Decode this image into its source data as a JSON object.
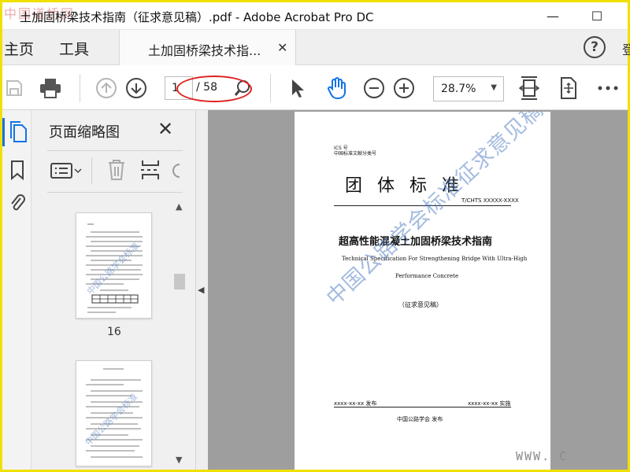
{
  "window": {
    "title": "土加固桥梁技术指南（征求意见稿）.pdf - Adobe Acrobat Pro DC",
    "watermark_top": "中国道桥网",
    "minimize": "—",
    "maximize": "☐"
  },
  "tabs": {
    "home": "主页",
    "tools": "工具",
    "document": "土加固桥梁技术指...",
    "document_close": "✕",
    "help": "?",
    "cut_label": "登"
  },
  "toolbar": {
    "current_page": "1",
    "total_pages": "/ 58",
    "zoom": "28.7%"
  },
  "thumbnails_panel": {
    "title": "页面缩略图",
    "close": "✕",
    "pages": [
      {
        "label": "16"
      },
      {
        "label": ""
      }
    ]
  },
  "document_page": {
    "ics": "ICS 号",
    "classification": "中国标准文献分类号",
    "category": "团  体  标  准",
    "standard_number": "T/CHTS XXXXX-XXXX",
    "title_cn": "超高性能混凝土加固桥梁技术指南",
    "title_en_line1": "Technical Specification For Strengthening Bridge With Ultra-High",
    "title_en_line2": "Performance Concrete",
    "draft_note": "（征求意见稿）",
    "issue_date": "xxxx-xx-xx 发布",
    "implement_date": "xxxx-xx-xx 实施",
    "publisher": "中国公路学会  发布",
    "watermark": "中国公路学会标准征求意见稿"
  },
  "footer_watermark": "WWW. C",
  "colors": {
    "frame": "#f0e000",
    "accent": "#1473e6",
    "annotation": "#e02020",
    "doc_background": "#9e9e9e",
    "watermark": "#5b84c6"
  }
}
